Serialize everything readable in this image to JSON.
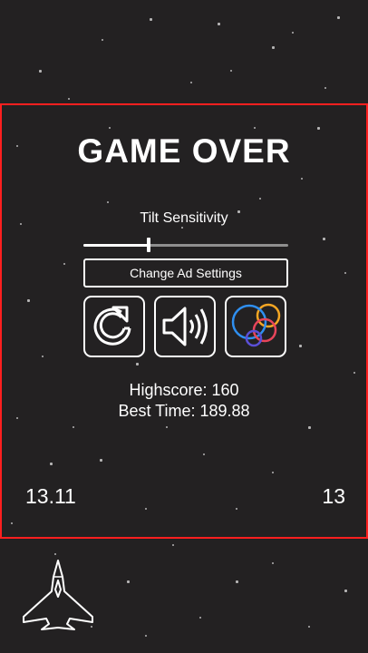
{
  "game_over": {
    "title": "GAME OVER",
    "tilt_label": "Tilt Sensitivity",
    "tilt_sensitivity": 0.32,
    "ad_button_label": "Change Ad Settings",
    "highscore_text": "Highscore: 160",
    "best_time_text": "Best Time: 189.88"
  },
  "hud": {
    "time": "13.11",
    "score": "13"
  },
  "icons": {
    "restart": "restart-icon",
    "sound": "speaker-icon",
    "social": "game-center-icon"
  },
  "colors": {
    "background": "#232122",
    "panel_border": "#ff1f1f",
    "foreground": "#ffffff",
    "slider_track": "#8f8f8f",
    "social_circle_orange": "#f5a623",
    "social_circle_blue": "#2f8ff0",
    "social_circle_red": "#e8455a",
    "social_circle_purple": "#5b4fd6"
  }
}
